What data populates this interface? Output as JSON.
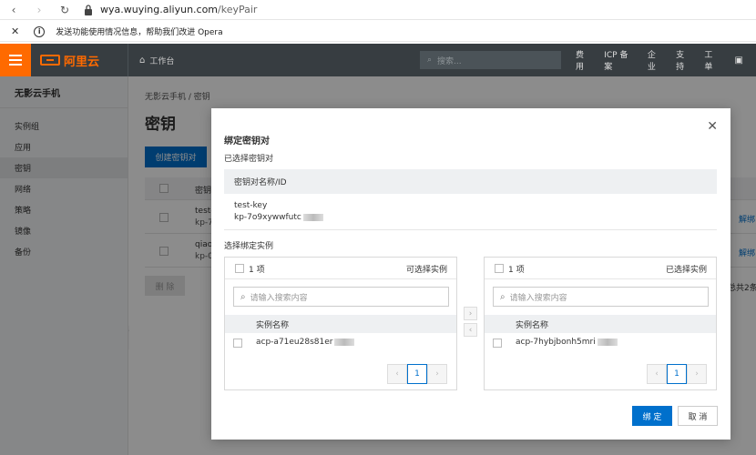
{
  "browser": {
    "url_domain": "wya.wuying.aliyun.com",
    "url_path": "/keyPair",
    "notice_text": "发送功能使用情况信息，帮助我们改进 Opera"
  },
  "topnav": {
    "logo_text": "阿里云",
    "workbench": "工作台",
    "search_placeholder": "搜索...",
    "links": [
      "费用",
      "ICP 备案",
      "企业",
      "支持",
      "工单"
    ]
  },
  "sidebar": {
    "title": "无影云手机",
    "items": [
      {
        "label": "实例组"
      },
      {
        "label": "应用"
      },
      {
        "label": "密钥"
      },
      {
        "label": "网络"
      },
      {
        "label": "策略"
      },
      {
        "label": "镜像"
      },
      {
        "label": "备份"
      }
    ]
  },
  "main": {
    "breadcrumb": "无影云手机  /  密钥",
    "page_title": "密钥",
    "create_button": "创建密钥对",
    "table_col": "密钥",
    "rows": [
      {
        "l1": "test-",
        "l2": "kp-7",
        "action": "解绑"
      },
      {
        "l1": "qiao",
        "l2": "kp-0",
        "action": "解绑"
      }
    ],
    "delete_button": "删 除",
    "total": "总共2条"
  },
  "modal": {
    "title": "绑定密钥对",
    "selected_label": "已选择密钥对",
    "key_col": "密钥对名称/ID",
    "key_name": "test-key",
    "key_id": "kp-7o9xywwfutc",
    "choose_label": "选择绑定实例",
    "left_panel": {
      "count": "1 项",
      "title": "可选择实例",
      "search_placeholder": "请输入搜索内容",
      "col": "实例名称",
      "item": "acp-a71eu28s81er",
      "page": "1"
    },
    "right_panel": {
      "count": "1 项",
      "title": "已选择实例",
      "search_placeholder": "请输入搜索内容",
      "col": "实例名称",
      "item": "acp-7hybjbonh5mri",
      "page": "1"
    },
    "bind_button": "绑 定",
    "cancel_button": "取 消"
  }
}
